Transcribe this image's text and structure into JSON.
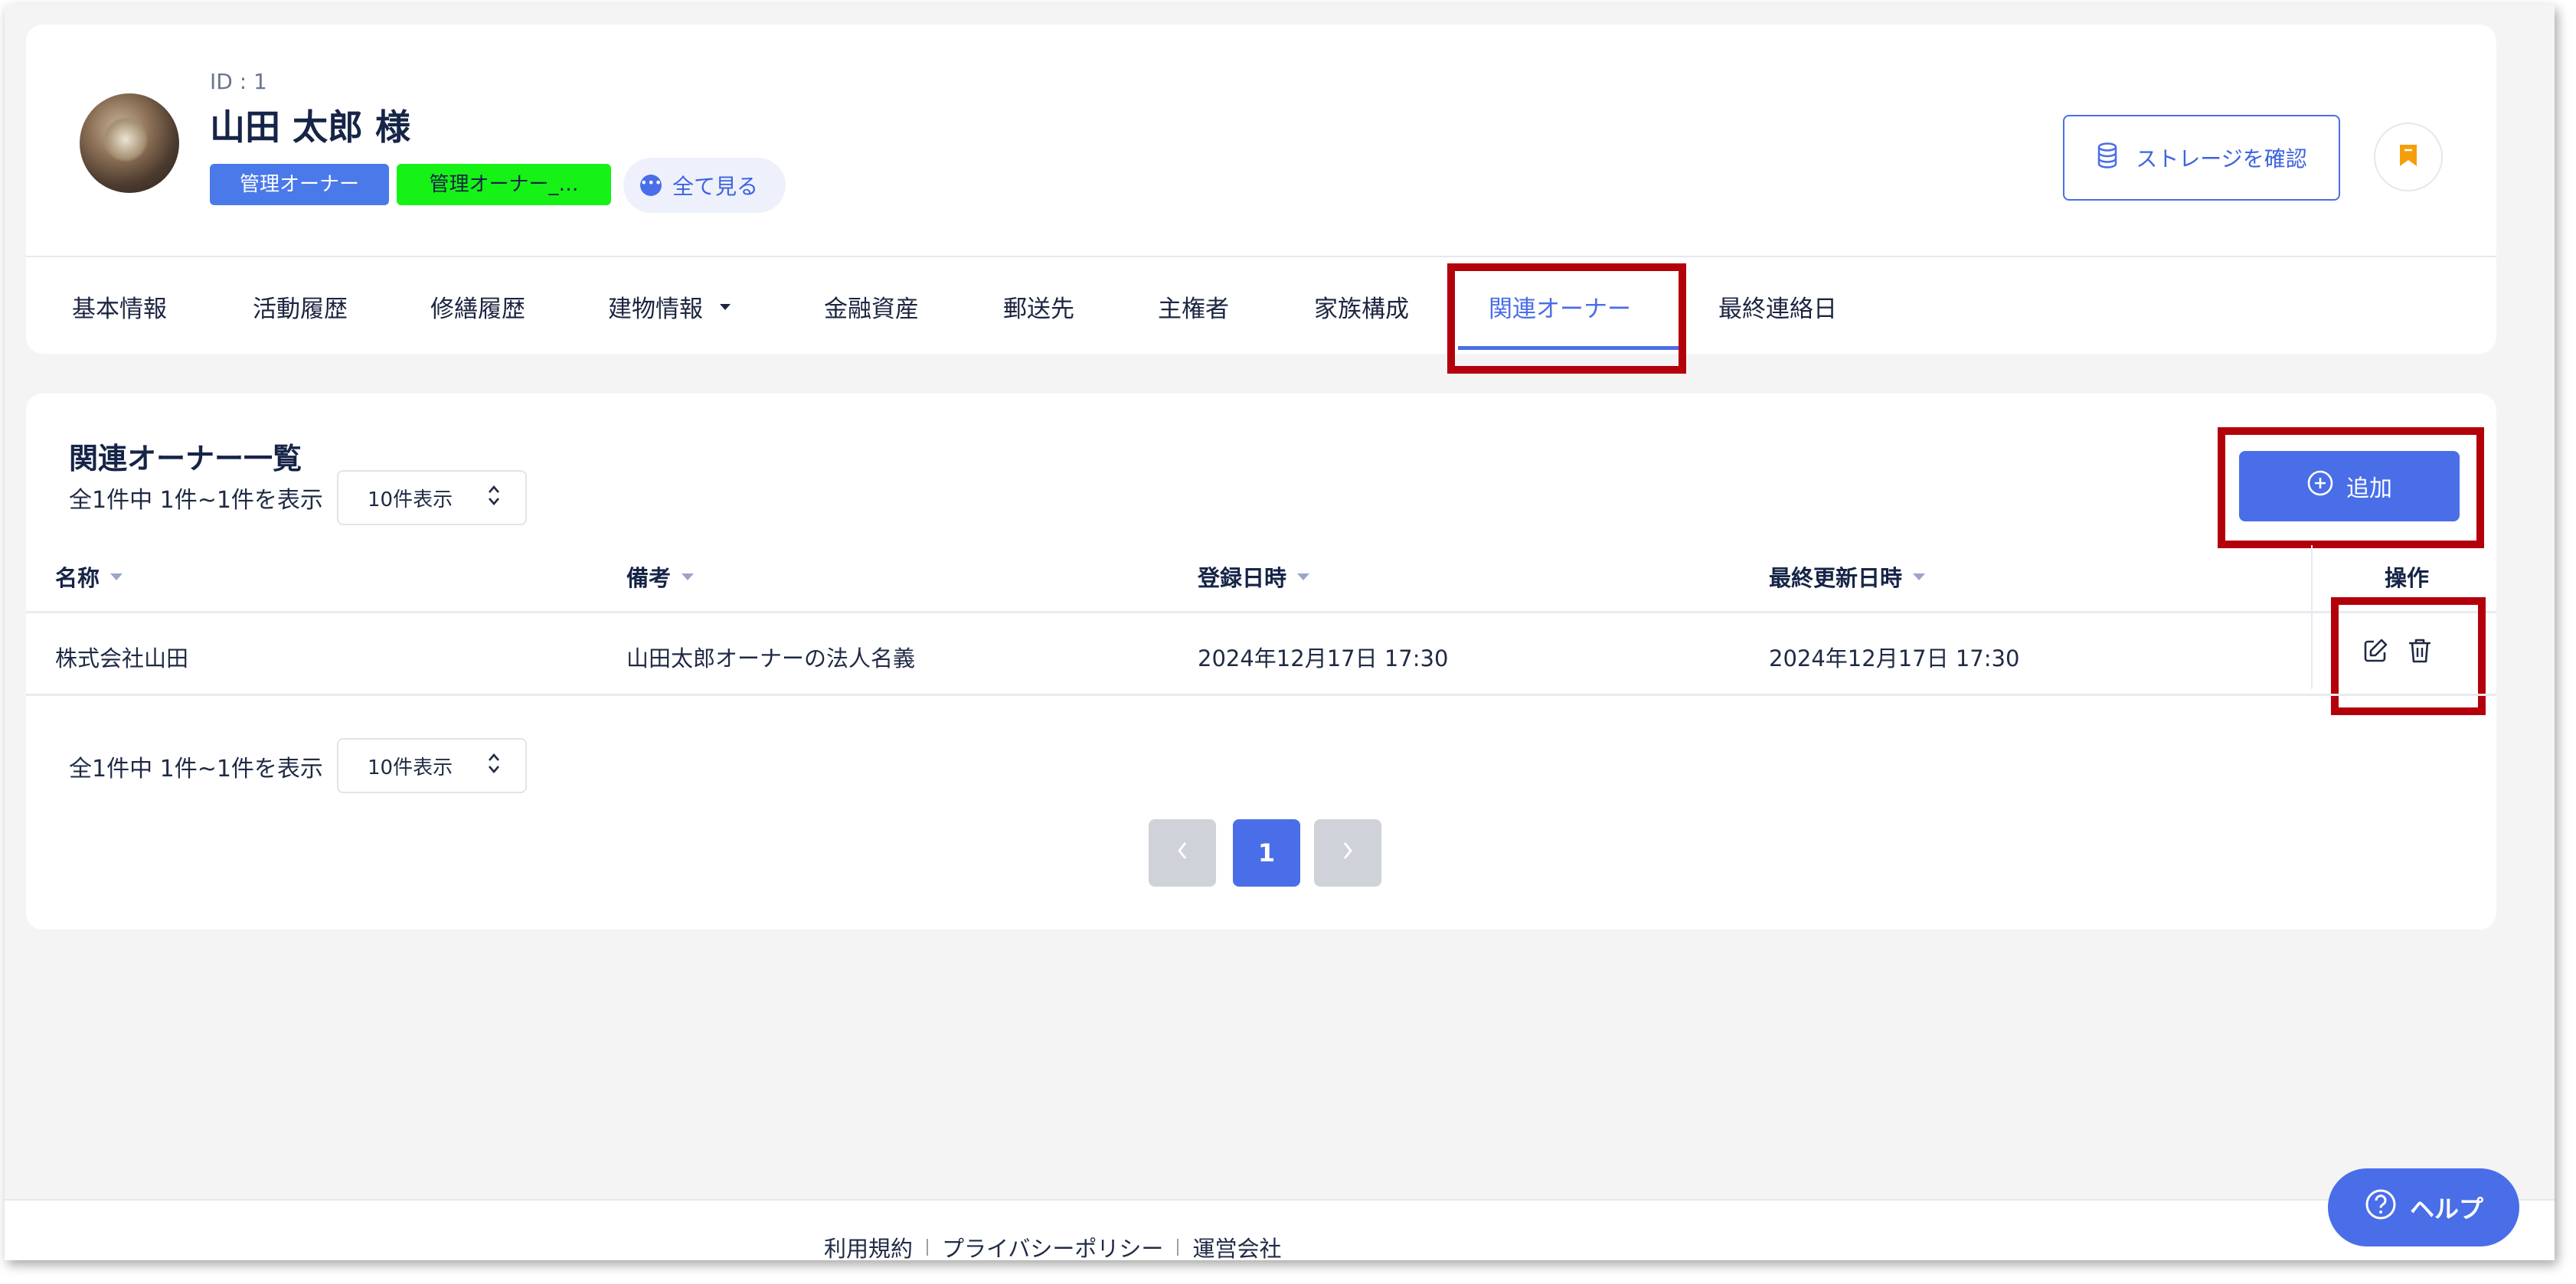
{
  "profile": {
    "id_label": "ID : 1",
    "name": "山田 太郎 様",
    "tags": [
      "管理オーナー",
      "管理オーナー_…"
    ],
    "see_all": "全て見る",
    "storage_button": "ストレージを確認"
  },
  "tabs": [
    {
      "label": "基本情報"
    },
    {
      "label": "活動履歴"
    },
    {
      "label": "修繕履歴"
    },
    {
      "label": "建物情報"
    },
    {
      "label": "金融資産"
    },
    {
      "label": "郵送先"
    },
    {
      "label": "主権者"
    },
    {
      "label": "家族構成"
    },
    {
      "label": "関連オーナー",
      "active": true
    },
    {
      "label": "最終連絡日"
    }
  ],
  "list": {
    "title": "関連オーナー一覧",
    "count_text": "全1件中 1件~1件を表示",
    "per_page": "10件表示",
    "add_button": "追加",
    "columns": [
      "名称",
      "備考",
      "登録日時",
      "最終更新日時",
      "操作"
    ],
    "rows": [
      {
        "name": "株式会社山田",
        "note": "山田太郎オーナーの法人名義",
        "created": "2024年12月17日 17:30",
        "updated": "2024年12月17日 17:30"
      }
    ]
  },
  "pagination": {
    "current_page": "1"
  },
  "footer": {
    "links": [
      "利用規約",
      "プライバシーポリシー",
      "運営会社"
    ]
  },
  "help_button": "ヘルプ",
  "colors": {
    "accent": "#4a6ee8",
    "tag_blue": "#4a79ea",
    "tag_green": "#16f216",
    "highlight": "#b3000b",
    "bookmark": "#f59e0b"
  }
}
